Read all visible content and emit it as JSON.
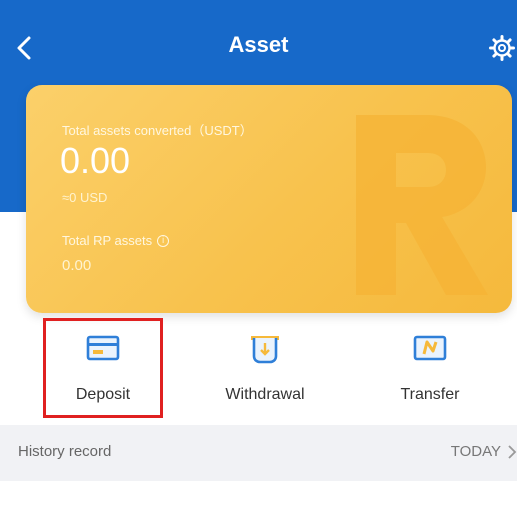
{
  "header": {
    "title": "Asset",
    "back_icon": "chevron-left-icon",
    "settings_icon": "gear-icon",
    "color": "#1769c9"
  },
  "asset_card": {
    "total_label": "Total assets converted（USDT）",
    "total_value": "0.00",
    "usd_value": "≈0 USD",
    "rp_label": "Total RP assets",
    "rp_value": "0.00",
    "color": "#f8c24d"
  },
  "actions": [
    {
      "label": "Deposit",
      "icon": "card-icon",
      "highlighted": true
    },
    {
      "label": "Withdrawal",
      "icon": "withdraw-icon",
      "highlighted": false
    },
    {
      "label": "Transfer",
      "icon": "transfer-icon",
      "highlighted": false
    }
  ],
  "history": {
    "title": "History record",
    "filter": "TODAY"
  },
  "colors": {
    "highlight_border": "#e02020",
    "icon_blue": "#2f7fd8",
    "icon_yellow": "#f6b93a"
  }
}
